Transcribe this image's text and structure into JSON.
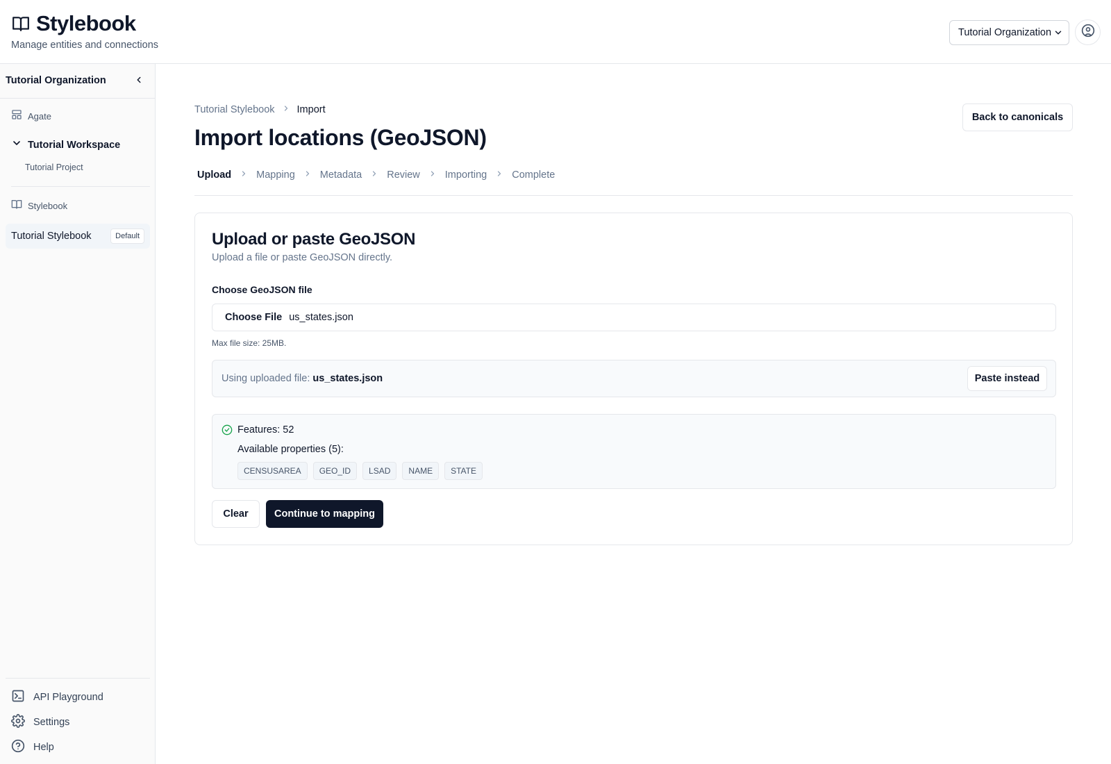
{
  "header": {
    "brand": "Stylebook",
    "subtitle": "Manage entities and connections",
    "org_select": "Tutorial Organization"
  },
  "sidebar": {
    "org_name": "Tutorial Organization",
    "sections": [
      {
        "label": "Agate",
        "icon": "layout-icon"
      },
      {
        "label": "Stylebook",
        "icon": "book-icon"
      }
    ],
    "workspace": "Tutorial Workspace",
    "project": "Tutorial Project",
    "active_item": {
      "label": "Tutorial Stylebook",
      "badge": "Default"
    },
    "bottom_items": [
      {
        "label": "API Playground",
        "icon": "terminal-icon"
      },
      {
        "label": "Settings",
        "icon": "gear-icon"
      },
      {
        "label": "Help",
        "icon": "help-icon"
      }
    ]
  },
  "main": {
    "breadcrumb": [
      "Tutorial Stylebook",
      "Import"
    ],
    "back_button": "Back to canonicals",
    "title": "Import locations (GeoJSON)",
    "steps": [
      "Upload",
      "Mapping",
      "Metadata",
      "Review",
      "Importing",
      "Complete"
    ],
    "active_step": "Upload"
  },
  "card": {
    "title": "Upload or paste GeoJSON",
    "subtitle": "Upload a file or paste GeoJSON directly.",
    "field_label": "Choose GeoJSON file",
    "file_button": "Choose File",
    "file_name": "us_states.json",
    "hint": "Max file size: 25MB.",
    "using_prefix": "Using uploaded file:",
    "using_file": "us_states.json",
    "paste_button": "Paste instead",
    "features": "Features: 52",
    "available": "Available properties (5):",
    "properties": [
      "CENSUSAREA",
      "GEO_ID",
      "LSAD",
      "NAME",
      "STATE"
    ],
    "clear_button": "Clear",
    "continue_button": "Continue to mapping"
  },
  "colors": {
    "primary": "#0f172a",
    "muted": "#64748b",
    "border": "#e5e7eb",
    "success": "#16a34a",
    "sidebar_bg": "#fafafa"
  }
}
